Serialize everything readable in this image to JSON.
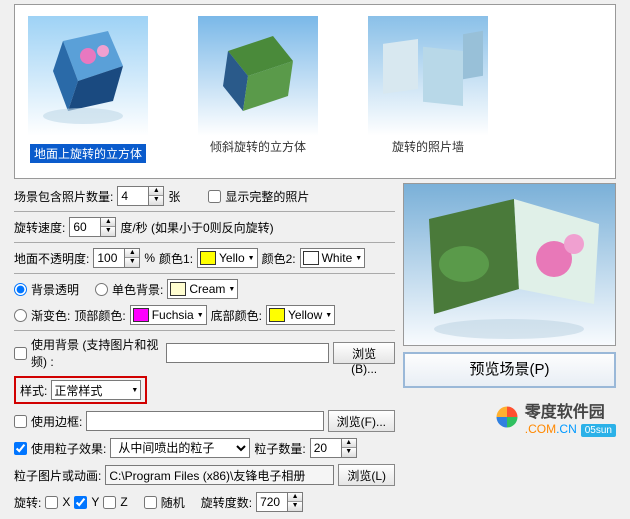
{
  "gallery": {
    "items": [
      {
        "label": "地面上旋转的立方体",
        "selected": true
      },
      {
        "label": "倾斜旋转的立方体",
        "selected": false
      },
      {
        "label": "旋转的照片墙",
        "selected": false
      }
    ]
  },
  "photo_count": {
    "label": "场景包含照片数量:",
    "value": "4",
    "unit": "张"
  },
  "show_full": {
    "label": "显示完整的照片",
    "checked": false
  },
  "rotate_speed": {
    "label": "旋转速度:",
    "value": "60",
    "unit": "度/秒 (如果小于0则反向旋转)"
  },
  "ground_opacity": {
    "label": "地面不透明度:",
    "value": "100",
    "pct": "%"
  },
  "color1": {
    "label": "颜色1:",
    "name": "Yello",
    "hex": "#ffff00"
  },
  "color2": {
    "label": "颜色2:",
    "name": "White",
    "hex": "#ffffff"
  },
  "bg_mode": {
    "transparent": {
      "label": "背景透明",
      "checked": true
    },
    "solid": {
      "label": "单色背景:",
      "checked": false,
      "color_name": "Cream",
      "color_hex": "#fffdd0"
    },
    "gradient": {
      "label": "渐变色:",
      "checked": false
    },
    "top": {
      "label": "顶部颜色:",
      "name": "Fuchsia",
      "hex": "#ff00ff"
    },
    "bottom": {
      "label": "底部颜色:",
      "name": "Yellow",
      "hex": "#ffff00"
    }
  },
  "use_bg_media": {
    "label": "使用背景 (支持图片和视频) :",
    "checked": false,
    "value": ""
  },
  "browse_b": "浏览(B)...",
  "style": {
    "label": "样式:",
    "value": "正常样式"
  },
  "use_border": {
    "label": "使用边框:",
    "checked": false
  },
  "browse_f": "浏览(F)...",
  "use_particle": {
    "label": "使用粒子效果:",
    "checked": true,
    "select": "从中间喷出的粒子"
  },
  "particle_count": {
    "label": "粒子数量:",
    "value": "20"
  },
  "particle_img": {
    "label": "粒子图片或动画:",
    "value": "C:\\Program Files (x86)\\友锋电子相册"
  },
  "browse_l": "浏览(L)",
  "rotate_axis": {
    "label": "旋转:",
    "x": {
      "label": "X",
      "checked": false
    },
    "y": {
      "label": "Y",
      "checked": true
    },
    "z": {
      "label": "Z",
      "checked": false
    }
  },
  "random": {
    "label": "随机",
    "checked": false
  },
  "rotate_count": {
    "label": "旋转度数:",
    "value": "720"
  },
  "preview_btn": "预览场景(P)",
  "brand": {
    "name": "零度软件园",
    "com": ".COM",
    "cn": ".CN",
    "tag": "05sun"
  }
}
